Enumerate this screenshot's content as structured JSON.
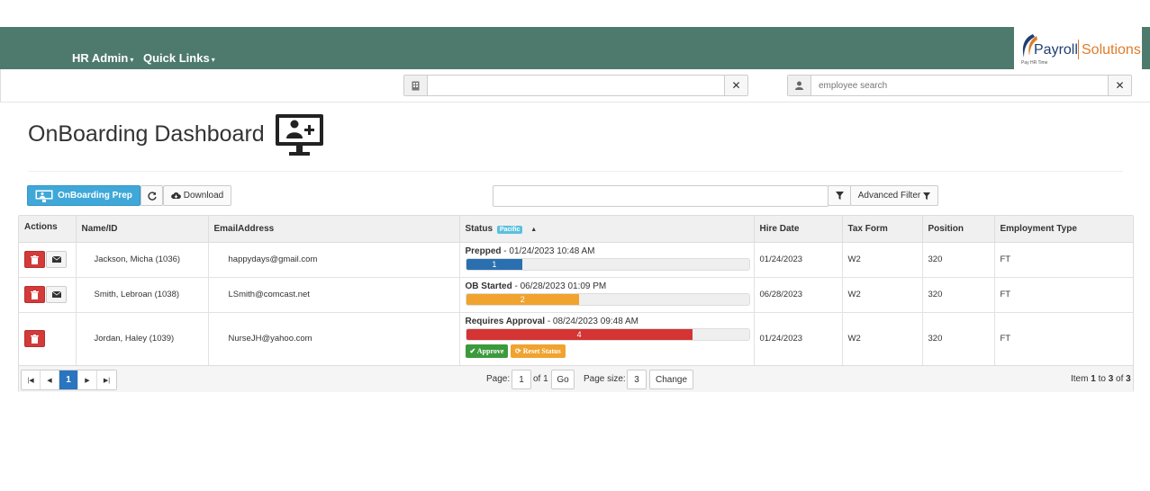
{
  "nav": {
    "items": [
      {
        "label": "HR Admin"
      },
      {
        "label": "Quick Links"
      }
    ],
    "caret": "▾"
  },
  "logo": {
    "word1": "Payroll",
    "word2": "Solutions",
    "tagline": "Pay HR Time",
    "colors": {
      "primary": "#1f3e72",
      "accent": "#e07b2a"
    }
  },
  "search": {
    "company": {
      "value": "",
      "icon": "building-icon",
      "clear": "✕"
    },
    "employee": {
      "placeholder": "employee search",
      "icon": "user-icon",
      "clear": "✕"
    }
  },
  "page": {
    "title": "OnBoarding Dashboard",
    "icon": "monitor-add-user-icon"
  },
  "toolbar": {
    "onboarding_prep_label": "OnBoarding Prep",
    "refresh_icon": "refresh-icon",
    "download_label": "Download",
    "filter_value": "",
    "advanced_filter_label": "Advanced Filter"
  },
  "table": {
    "columns": [
      "Actions",
      "Name/ID",
      "EmailAddress",
      "Status",
      "Hire Date",
      "Tax Form",
      "Position",
      "Employment Type"
    ],
    "status_badge": "Pacific",
    "sort_indicator": "▲",
    "rows": [
      {
        "name": "Jackson, Micha (1036)",
        "email": "happydays@gmail.com",
        "status": "Prepped",
        "status_date": " - 01/24/2023 10:48 AM",
        "step": "1",
        "progress": 0.2,
        "color": "#2a6fb0",
        "hire_date": "01/24/2023",
        "tax_form": "W2",
        "position": "320",
        "employment_type": "FT",
        "has_mail": true
      },
      {
        "name": "Smith, Lebroan (1038)",
        "email": "LSmith@comcast.net",
        "status": "OB Started",
        "status_date": " - 06/28/2023 01:09 PM",
        "step": "2",
        "progress": 0.4,
        "color": "#f0a32e",
        "hire_date": "06/28/2023",
        "tax_form": "W2",
        "position": "320",
        "employment_type": "FT",
        "has_mail": true
      },
      {
        "name": "Jordan, Haley (1039)",
        "email": "NurseJH@yahoo.com",
        "status": "Requires Approval",
        "status_date": " - 08/24/2023 09:48 AM",
        "step": "4",
        "progress": 0.8,
        "color": "#d43434",
        "hire_date": "01/24/2023",
        "tax_form": "W2",
        "position": "320",
        "employment_type": "FT",
        "has_mail": false,
        "approve_label": "✔ Approve",
        "reset_label": "⟳ Reset Status"
      }
    ]
  },
  "pager": {
    "current_page": "1",
    "page_label": "Page:",
    "page_value": "1",
    "of_label": "of 1",
    "go_label": "Go",
    "size_label": "Page size:",
    "size_value": "3",
    "change_label": "Change",
    "item_prefix": "Item ",
    "item_from": "1",
    "item_mid": " to ",
    "item_to": "3",
    "item_of": " of ",
    "item_total": "3"
  }
}
